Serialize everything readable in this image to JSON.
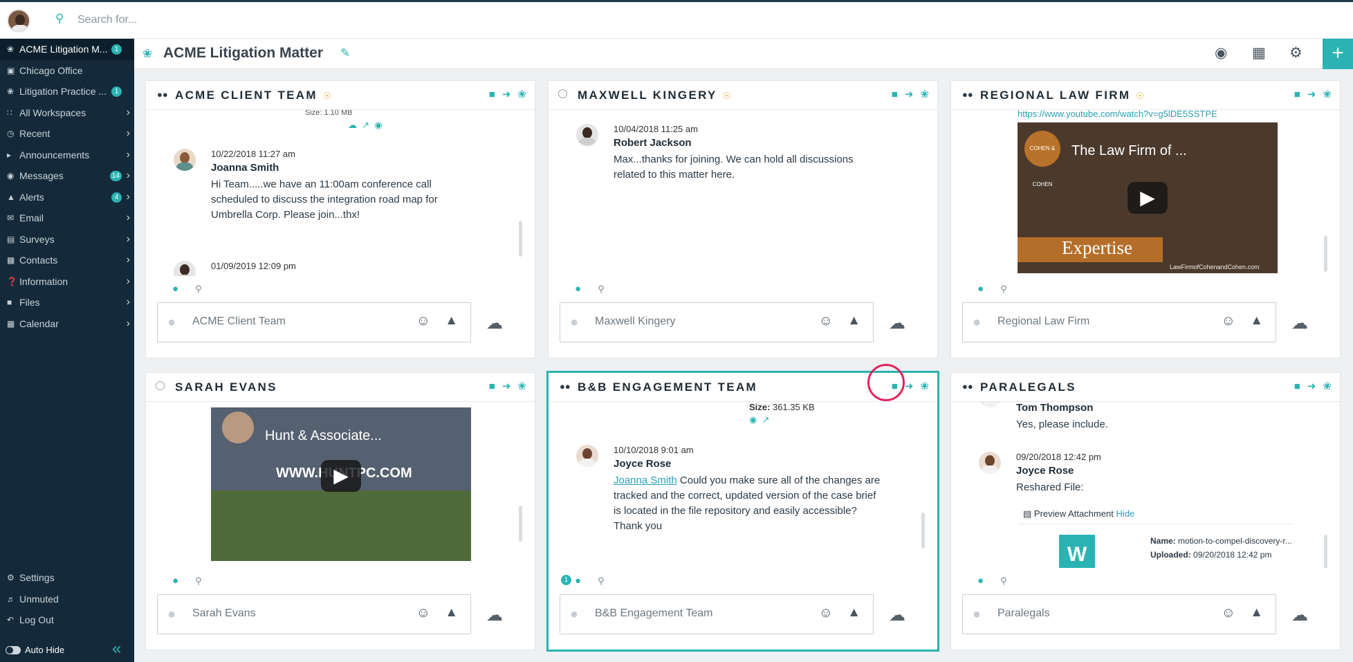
{
  "search": {
    "placeholder": "Search for..."
  },
  "sidebar": {
    "items": [
      {
        "label": "ACME Litigation M...",
        "badge": "1",
        "icon": "bug-icon"
      },
      {
        "label": "Chicago Office",
        "badge": "",
        "icon": "briefcase-icon"
      },
      {
        "label": "Litigation Practice ...",
        "badge": "1",
        "icon": "folder-icon"
      },
      {
        "label": "All Workspaces",
        "badge": "",
        "icon": "grid-icon"
      },
      {
        "label": "Recent",
        "badge": "",
        "icon": "clock-icon"
      },
      {
        "label": "Announcements",
        "badge": "",
        "icon": "megaphone-icon"
      },
      {
        "label": "Messages",
        "badge": "14",
        "icon": "chat-icon"
      },
      {
        "label": "Alerts",
        "badge": "4",
        "icon": "warning-icon"
      },
      {
        "label": "Email",
        "badge": "",
        "icon": "email-icon"
      },
      {
        "label": "Surveys",
        "badge": "",
        "icon": "survey-icon"
      },
      {
        "label": "Contacts",
        "badge": "",
        "icon": "contact-icon"
      },
      {
        "label": "Information",
        "badge": "",
        "icon": "question-icon"
      },
      {
        "label": "Files",
        "badge": "",
        "icon": "folder-icon"
      },
      {
        "label": "Calendar",
        "badge": "",
        "icon": "calendar-icon"
      }
    ],
    "bottom": [
      {
        "label": "Settings",
        "icon": "gear-icon"
      },
      {
        "label": "Unmuted",
        "icon": "speaker-icon"
      },
      {
        "label": "Log Out",
        "icon": "logout-icon"
      }
    ],
    "auto_hide": "Auto Hide"
  },
  "workspace": {
    "title": "ACME Litigation Matter"
  },
  "panels": {
    "p1": {
      "title": "ACME CLIENT TEAM",
      "partial_line": "Size: 1.10 MB",
      "msg": {
        "time": "10/22/2018 11:27 am",
        "name": "Joanna Smith",
        "text": "Hi Team.....we have an 11:00am conference call scheduled to discuss the integration road map for Umbrella Corp. Please join...thx!"
      },
      "msg2_time": "01/09/2019 12:09 pm",
      "placeholder": "ACME Client Team"
    },
    "p2": {
      "title": "MAXWELL KINGERY",
      "msg": {
        "time": "10/04/2018 11:25 am",
        "name": "Robert Jackson",
        "text": "Max...thanks for joining. We can hold all discussions related to this matter here."
      },
      "placeholder": "Maxwell Kingery"
    },
    "p3": {
      "title": "REGIONAL LAW FIRM",
      "link": "https://www.youtube.com/watch?v=g5lDE5SSTPE",
      "video_title": "The Law Firm of ...",
      "video_brand": "Expertise",
      "logo_text": "COHEN & COHEN",
      "footer_text": "LawFirmofCohenandCohen.com",
      "placeholder": "Regional Law Firm"
    },
    "p4": {
      "title": "SARAH EVANS",
      "video_title": "Hunt & Associate...",
      "video_brand": "WWW.HUNTPC.COM",
      "placeholder": "Sarah Evans"
    },
    "p5": {
      "title": "B&B ENGAGEMENT TEAM",
      "size_label": "Size:",
      "size_value": "361.35 KB",
      "msg": {
        "time": "10/10/2018 9:01 am",
        "name": "Joyce Rose",
        "mention": "Joanna Smith",
        "text": " Could you make sure all of the changes are tracked and the correct, updated version of the case brief is located in the file repository and easily accessible? Thank you"
      },
      "unread": "1",
      "placeholder": "B&B Engagement Team"
    },
    "p6": {
      "title": "PARALEGALS",
      "msg0": {
        "name": "Tom Thompson",
        "text": "Yes, please include."
      },
      "msg": {
        "time": "09/20/2018 12:42 pm",
        "name": "Joyce Rose",
        "text": "Reshared File:"
      },
      "preview": "Preview Attachment",
      "hide": "Hide",
      "file_name_label": "Name:",
      "file_name": "motion-to-compel-discovery-r...",
      "uploaded_label": "Uploaded:",
      "uploaded": "09/20/2018 12:42 pm",
      "placeholder": "Paralegals"
    }
  },
  "colors": {
    "accent": "#2bb3b3",
    "sidebar": "#142a3a",
    "highlight": "#e2245c",
    "external": "#f0a21b"
  }
}
